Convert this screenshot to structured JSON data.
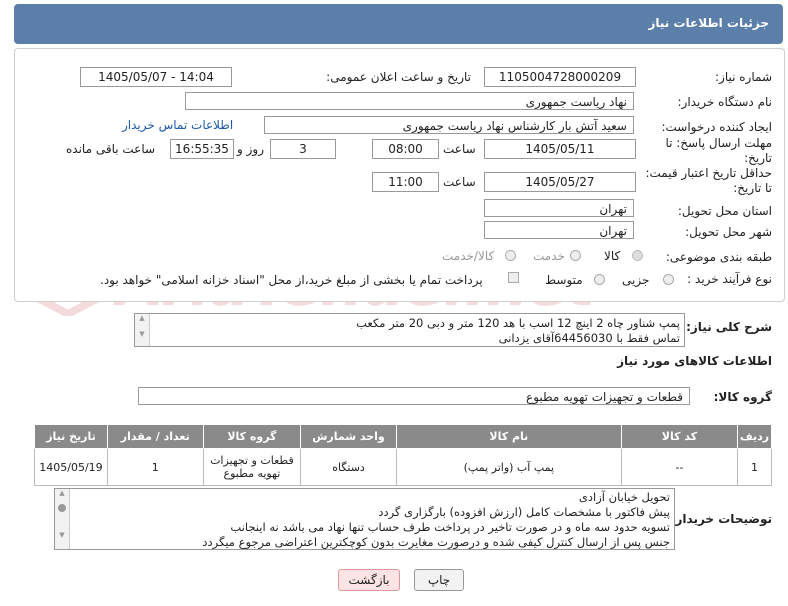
{
  "header": {
    "title": "جزئیات اطلاعات نیاز"
  },
  "form": {
    "need_number_label": "شماره نیاز:",
    "need_number": "1105004728000209",
    "announce_label": "تاریخ و ساعت اعلان عمومی:",
    "announce_value": "1405/05/07 - 14:04",
    "buyer_org_label": "نام دستگاه خریدار:",
    "buyer_org": "نهاد ریاست جمهوری",
    "creator_label": "ایجاد کننده درخواست:",
    "creator": "سعید آتش بار کارشناس نهاد ریاست جمهوری",
    "contact_link": "اطلاعات تماس خریدار",
    "deadline_label_1": "مهلت ارسال پاسخ: تا",
    "deadline_label_2": "تاریخ:",
    "deadline_date": "1405/05/11",
    "hour_label": "ساعت",
    "deadline_time": "08:00",
    "days_value": "3",
    "days_label": "روز و",
    "remaining_time": "16:55:35",
    "remaining_label": "ساعت باقی مانده",
    "price_label_1": "حداقل تاریخ اعتبار قیمت:",
    "price_label_2": "تا تاریخ:",
    "price_date": "1405/05/27",
    "price_time": "11:00",
    "province_label": "استان محل تحویل:",
    "province": "تهران",
    "city_label": "شهر محل تحویل:",
    "city": "تهران",
    "category_label": "طبقه بندی موضوعی:",
    "category_options": [
      "کالا",
      "خدمت",
      "کالا/خدمت"
    ],
    "category_selected": "کالا",
    "process_label": "نوع فرآیند خرید :",
    "process_options": [
      "جزیی",
      "متوسط"
    ],
    "payment_text": "پرداخت تمام یا بخشی از مبلغ خرید،از محل \"اسناد خزانه اسلامی\" خواهد بود."
  },
  "general": {
    "label": "شرح کلی نیاز:",
    "line1": "پمپ شناور چاه 2 اینچ 12 اسب با هد 120 متر و دبی 20 متر مکعب",
    "line2": "تماس فقط با 64456030آقای یزدانی"
  },
  "goods": {
    "section_title": "اطلاعات کالاهای مورد نیاز",
    "group_label": "گروه کالا:",
    "group_value": "قطعات و تجهیزات تهویه مطبوع",
    "columns": [
      "ردیف",
      "کد کالا",
      "نام کالا",
      "واحد شمارش",
      "گروه کالا",
      "تعداد / مقدار",
      "تاریخ نیاز"
    ],
    "rows": [
      [
        "1",
        "--",
        "پمپ آب (واتر پمپ)",
        "دستگاه",
        "قطعات و تجهیزات تهویه مطبوع",
        "1",
        "1405/05/19"
      ]
    ]
  },
  "notes": {
    "label": "توضیحات خریدار:",
    "lines": [
      "تحویل خیابان آزادی",
      "پیش فاکتور با مشخصات کامل (ارزش افزوده) بارگزاری گردد",
      "تسویه حدود سه ماه و در صورت تاخیر در پرداخت طرف حساب تنها نهاد می باشد نه اینجانب",
      "جنس پس از ارسال کنترل کیفی شده و درصورت مغایرت بدون کوچکترین اعتراضی مرجوع میگردد"
    ]
  },
  "buttons": {
    "print": "چاپ",
    "back": "بازگشت"
  },
  "watermark": "AriaTender.net"
}
